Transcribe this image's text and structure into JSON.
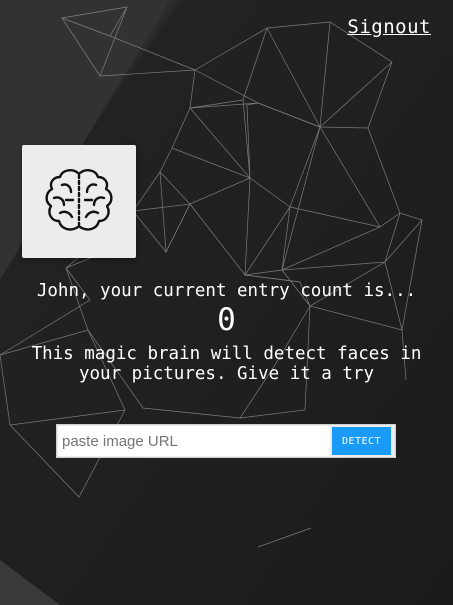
{
  "nav": {
    "signout_label": "Signout"
  },
  "logo": {
    "icon": "brain-icon"
  },
  "rank": {
    "entry_text": "John, your current entry count is...",
    "entry_count": "0"
  },
  "intro": {
    "description": "This magic brain will detect faces in your pictures. Give it a try"
  },
  "form": {
    "url_placeholder": "paste image URL",
    "url_value": "",
    "detect_label": "DETECT"
  },
  "colors": {
    "background": "#232323",
    "accent": "#1a9bf7",
    "card": "#ececec"
  }
}
